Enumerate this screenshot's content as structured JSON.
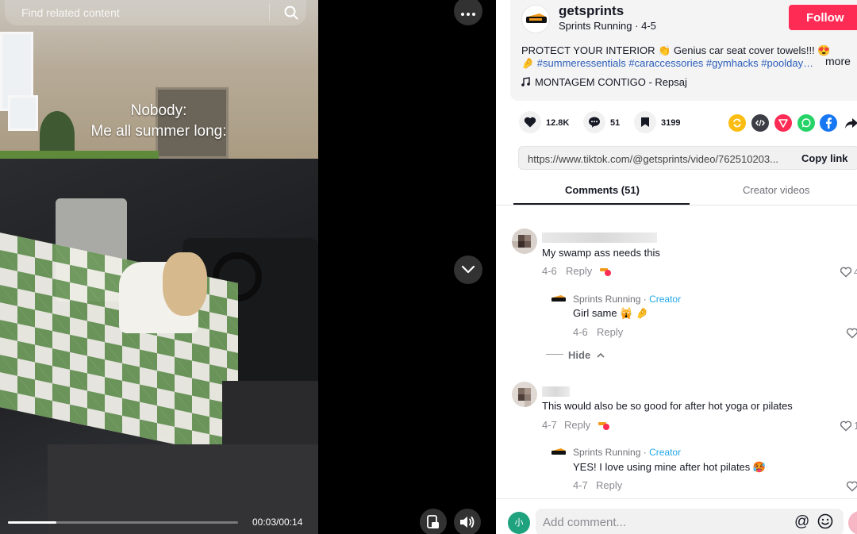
{
  "search": {
    "placeholder": "Find related content"
  },
  "video": {
    "overlay_line1": "Nobody:",
    "overlay_line2": "Me all summer long:",
    "time": "00:03/00:14",
    "progress": 0.21
  },
  "author": {
    "username": "getsprints",
    "display_name": "Sprints Running",
    "date": "4-5",
    "follow_label": "Follow"
  },
  "description": {
    "text": "PROTECT YOUR INTERIOR 👏 Genius car seat cover towels!!! 😍",
    "tags": "🤌 #summeressentials #caraccessories #gymhacks #poolday…",
    "more_label": "more",
    "music": "MONTAGEM CONTIGO - Repsaj"
  },
  "actions": {
    "likes": "12.8K",
    "comments": "51",
    "saves": "3199"
  },
  "share": {
    "url": "https://www.tiktok.com/@getsprints/video/762510203...",
    "copy_label": "Copy link"
  },
  "tabs": {
    "comments_label": "Comments (51)",
    "creator_label": "Creator videos"
  },
  "comments": [
    {
      "text": "My swamp ass needs this",
      "date": "4-6",
      "reply_label": "Reply",
      "like_count": "4",
      "reply": {
        "author": "Sprints Running",
        "creator_tag": "Creator",
        "text": "Girl same 🙀 🤌",
        "date": "4-6",
        "reply_label": "Reply"
      }
    },
    {
      "text": "This would also be so good for after hot yoga or pilates",
      "date": "4-7",
      "reply_label": "Reply",
      "like_count": "1",
      "reply": {
        "author": "Sprints Running",
        "creator_tag": "Creator",
        "text": "YES! I love using mine after hot pilates 🥵",
        "date": "4-7",
        "reply_label": "Reply"
      }
    }
  ],
  "hide_label": "Hide",
  "separator": "·",
  "add_comment": {
    "placeholder": "Add comment...",
    "at_label": "@",
    "avatar_text": "小"
  },
  "colors": {
    "follow": "#fe2c55",
    "link": "#2b5db9",
    "creator": "#22a7e6"
  }
}
